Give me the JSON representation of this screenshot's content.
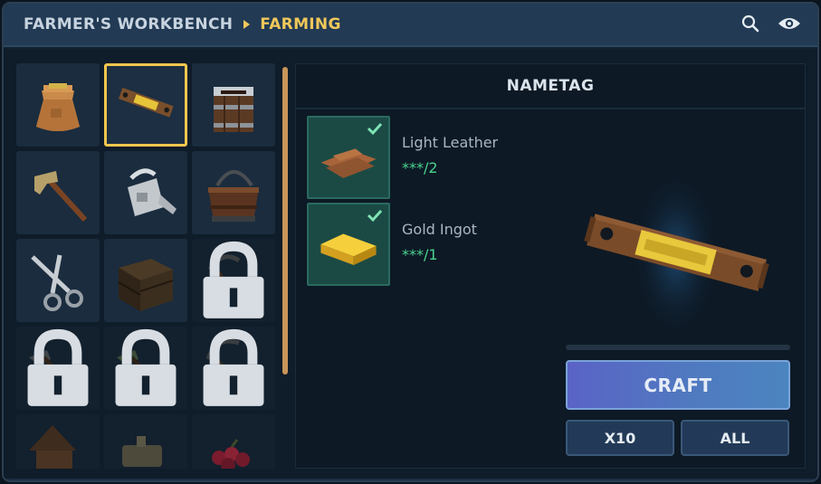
{
  "breadcrumb": {
    "root": "FARMER'S WORKBENCH",
    "current": "FARMING"
  },
  "title_icons": [
    "search-icon",
    "eye-icon"
  ],
  "grid": {
    "items": [
      {
        "name": "seed-bag-icon",
        "state": "available"
      },
      {
        "name": "nametag-icon",
        "state": "selected"
      },
      {
        "name": "bucket-icon",
        "state": "available"
      },
      {
        "name": "hoe-icon",
        "state": "available"
      },
      {
        "name": "watering-can-icon",
        "state": "available"
      },
      {
        "name": "basket-icon",
        "state": "available"
      },
      {
        "name": "shears-icon",
        "state": "available"
      },
      {
        "name": "crate-icon",
        "state": "available"
      },
      {
        "name": "sickle-icon",
        "state": "locked"
      },
      {
        "name": "iron-hoe-icon",
        "state": "locked"
      },
      {
        "name": "green-hoe-icon",
        "state": "locked"
      },
      {
        "name": "scythe-icon",
        "state": "locked"
      },
      {
        "name": "birdhouse-icon",
        "state": "partial"
      },
      {
        "name": "sprinkler-icon",
        "state": "partial"
      },
      {
        "name": "berries-icon",
        "state": "partial"
      }
    ]
  },
  "detail": {
    "title": "NAMETAG",
    "ingredients": [
      {
        "name": "Light Leather",
        "count": "***/2",
        "icon": "light-leather-icon",
        "status": "satisfied"
      },
      {
        "name": "Gold Ingot",
        "count": "***/1",
        "icon": "gold-ingot-icon",
        "status": "satisfied"
      }
    ],
    "preview_icon": "nametag-icon",
    "craft_label": "CRAFT",
    "x10_label": "X10",
    "all_label": "ALL"
  },
  "colors": {
    "accent_gold": "#f0c75a",
    "ingredient_ok": "#49d48f",
    "craft_button": "#5079c0"
  }
}
